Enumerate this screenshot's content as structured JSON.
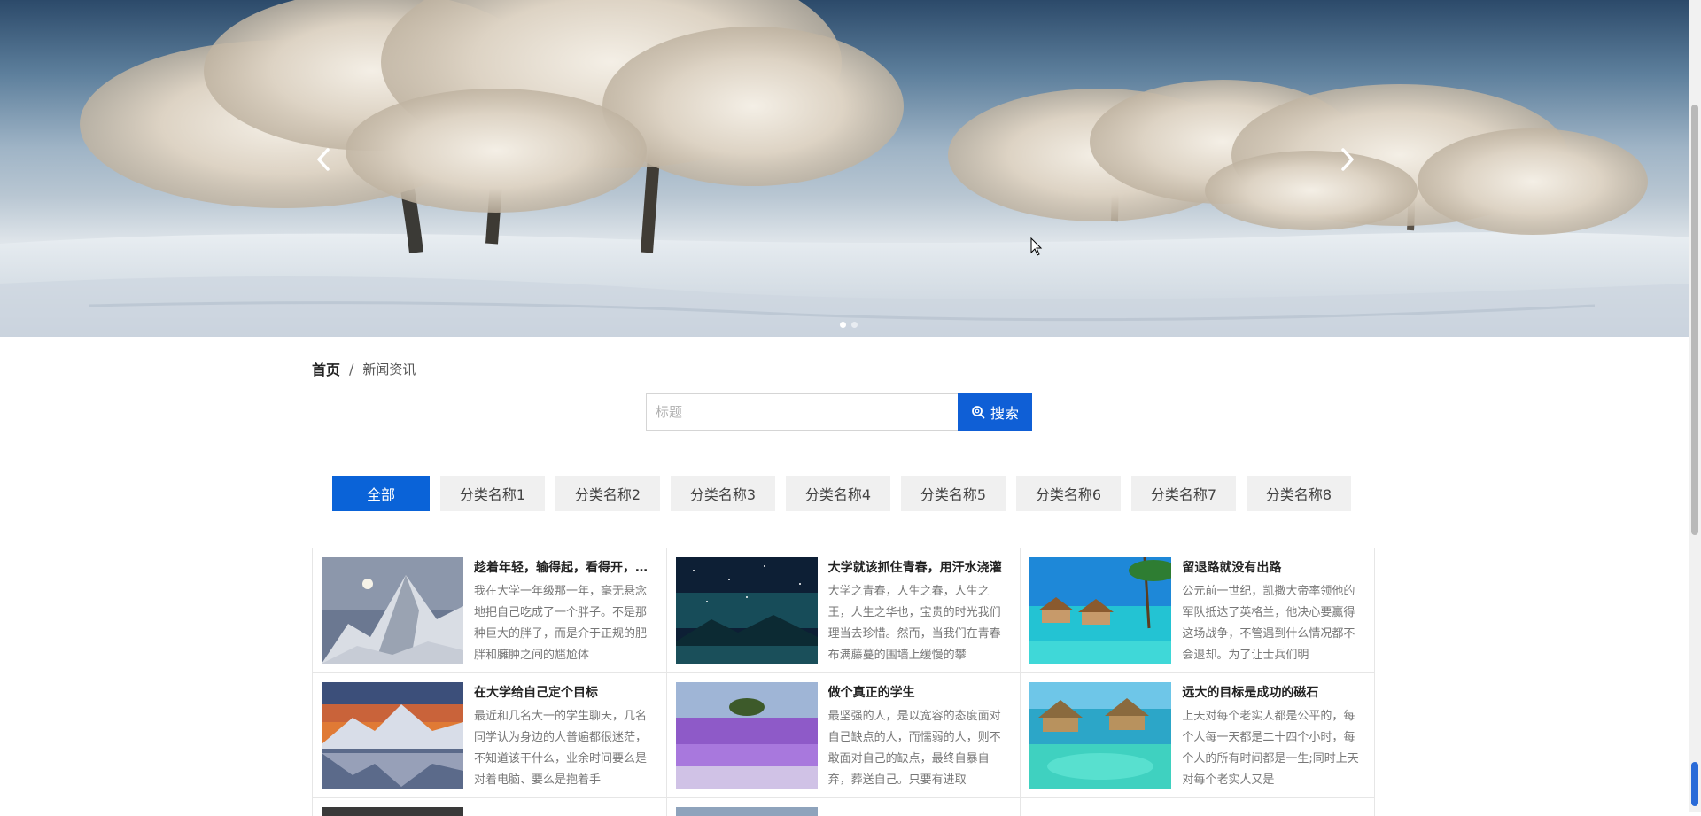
{
  "banner": {
    "prev_icon": "chevron-left-icon",
    "next_icon": "chevron-right-icon",
    "slide_count": 2,
    "active_slide": 1
  },
  "breadcrumb": {
    "home": "首页",
    "separator": "/",
    "current": "新闻资讯"
  },
  "search": {
    "placeholder": "标题",
    "button_label": "搜索",
    "button_icon": "search-icon",
    "accent": "#0f5fd6"
  },
  "categories": [
    {
      "label": "全部",
      "active": true
    },
    {
      "label": "分类名称1",
      "active": false
    },
    {
      "label": "分类名称2",
      "active": false
    },
    {
      "label": "分类名称3",
      "active": false
    },
    {
      "label": "分类名称4",
      "active": false
    },
    {
      "label": "分类名称5",
      "active": false
    },
    {
      "label": "分类名称6",
      "active": false
    },
    {
      "label": "分类名称7",
      "active": false
    },
    {
      "label": "分类名称8",
      "active": false
    }
  ],
  "news": [
    {
      "title": "趁着年轻，输得起，看得开，走得远",
      "text": "我在大学一年级那一年，毫无悬念地把自己吃成了一个胖子。不是那种巨大的胖子，而是介于正规的肥胖和臃肿之间的尴尬体",
      "image": "snowy-mountain-moon"
    },
    {
      "title": "大学就该抓住青春，用汗水浇灌",
      "text": "大学之青春，人生之春，人生之王，人生之华也，宝贵的时光我们理当去珍惜。然而，当我们在青春布满藤蔓的围墙上缓慢的攀",
      "image": "starry-night-lake"
    },
    {
      "title": "留退路就没有出路",
      "text": "公元前一世纪，凯撒大帝率领他的军队抵达了英格兰，他决心要赢得这场战争，不管遇到什么情况都不会退却。为了让士兵们明",
      "image": "beach-bungalows"
    },
    {
      "title": "在大学给自己定个目标",
      "text": "最近和几名大一的学生聊天，几名同学认为身边的人普遍都很迷茫，不知道该干什么，业余时间要么是对着电脑、要么是抱着手",
      "image": "sunset-mountain-lake"
    },
    {
      "title": "做个真正的学生",
      "text": "最坚强的人，是以宽容的态度面对自己缺点的人，而懦弱的人，则不敢面对自己的缺点，最终自暴自弃，葬送自己。只要有进取",
      "image": "lavender-field"
    },
    {
      "title": "远大的目标是成功的磁石",
      "text": "上天对每个老实人都是公平的，每个人每一天都是二十四个小时，每个人的所有时间都是一生;同时上天对每个老实人又是",
      "image": "tropical-lagoon-huts"
    }
  ]
}
